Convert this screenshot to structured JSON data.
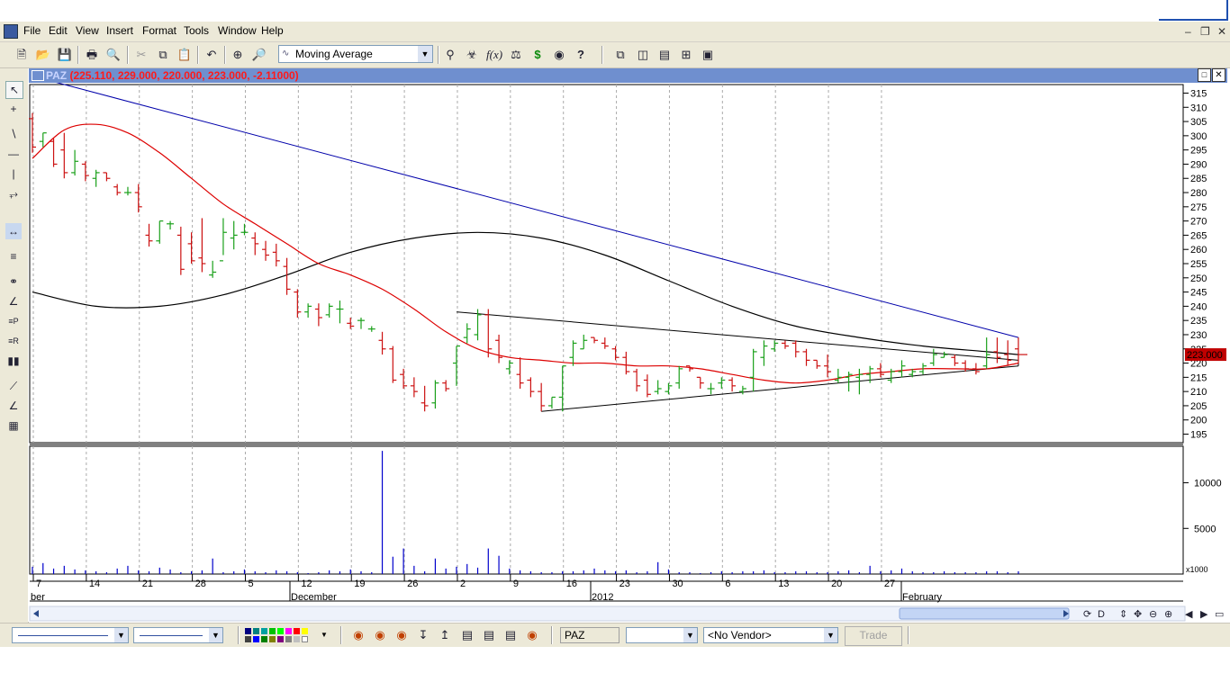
{
  "menu": {
    "items": [
      "File",
      "Edit",
      "View",
      "Insert",
      "Format",
      "Tools",
      "Window",
      "Help"
    ]
  },
  "toolbar": {
    "study_select": "Moving Average"
  },
  "chart_window": {
    "symbol": "PAZ",
    "ohlc_readout": "(225.110, 229.000, 220.000, 223.000, -2.11000)",
    "current_price_tag": "223.000",
    "volume_scale_label": "x1000"
  },
  "status_bar": {
    "symbol_field": "PAZ",
    "vendor": "<No Vendor>",
    "trade_button": "Trade"
  },
  "colors": {
    "price_up": "#1aa01a",
    "price_down": "#cc1111",
    "moving_average": "#dd0000",
    "long_average": "#000000",
    "trendline": "#0000aa",
    "volume": "#0000cc",
    "price_tag_bg": "#c00000"
  },
  "chart_data": {
    "type": "bar",
    "price_axis": {
      "ticks": [
        315,
        310,
        305,
        300,
        295,
        290,
        285,
        280,
        275,
        270,
        265,
        260,
        255,
        250,
        245,
        240,
        235,
        230,
        225,
        220,
        215,
        210,
        205,
        200,
        195
      ],
      "range": [
        192,
        318
      ]
    },
    "volume_axis": {
      "ticks": [
        10000,
        5000
      ],
      "range": [
        0,
        14000
      ]
    },
    "date_axis": {
      "day_labels": [
        "7",
        "14",
        "21",
        "28",
        "5",
        "12",
        "19",
        "26",
        "2",
        "9",
        "16",
        "23",
        "30",
        "6",
        "13",
        "20",
        "27"
      ],
      "month_labels": [
        "ber",
        "December",
        "2012",
        "February"
      ]
    },
    "bars": [
      {
        "o": 306,
        "h": 308,
        "l": 294,
        "c": 296
      },
      {
        "o": 298,
        "h": 301,
        "l": 296,
        "c": 301
      },
      {
        "o": 298,
        "h": 299,
        "l": 289,
        "c": 290
      },
      {
        "o": 295,
        "h": 301,
        "l": 285,
        "c": 287
      },
      {
        "o": 287,
        "h": 295,
        "l": 286,
        "c": 291
      },
      {
        "o": 290,
        "h": 291,
        "l": 284,
        "c": 286
      },
      {
        "o": 285,
        "h": 288,
        "l": 282,
        "c": 287
      },
      {
        "o": 287,
        "h": 287,
        "l": 284,
        "c": 285
      },
      {
        "o": 282,
        "h": 283,
        "l": 279,
        "c": 280
      },
      {
        "o": 280,
        "h": 282,
        "l": 279,
        "c": 280
      },
      {
        "o": 280,
        "h": 283,
        "l": 273,
        "c": 275
      },
      {
        "o": 265,
        "h": 269,
        "l": 261,
        "c": 263
      },
      {
        "o": 263,
        "h": 270,
        "l": 262,
        "c": 270
      },
      {
        "o": 269,
        "h": 270,
        "l": 267,
        "c": 269
      },
      {
        "o": 265,
        "h": 268,
        "l": 251,
        "c": 253
      },
      {
        "o": 262,
        "h": 266,
        "l": 255,
        "c": 256
      },
      {
        "o": 257,
        "h": 271,
        "l": 252,
        "c": 255
      },
      {
        "o": 251,
        "h": 256,
        "l": 250,
        "c": 252
      },
      {
        "o": 256,
        "h": 271,
        "l": 258,
        "c": 266
      },
      {
        "o": 264,
        "h": 270,
        "l": 260,
        "c": 265
      },
      {
        "o": 266,
        "h": 269,
        "l": 265,
        "c": 266
      },
      {
        "o": 264,
        "h": 266,
        "l": 258,
        "c": 262
      },
      {
        "o": 260,
        "h": 263,
        "l": 256,
        "c": 258
      },
      {
        "o": 259,
        "h": 262,
        "l": 254,
        "c": 256
      },
      {
        "o": 254,
        "h": 257,
        "l": 244,
        "c": 246
      },
      {
        "o": 245,
        "h": 246,
        "l": 236,
        "c": 238
      },
      {
        "o": 238,
        "h": 241,
        "l": 236,
        "c": 240
      },
      {
        "o": 239,
        "h": 241,
        "l": 233,
        "c": 236
      },
      {
        "o": 237,
        "h": 241,
        "l": 236,
        "c": 240
      },
      {
        "o": 239,
        "h": 242,
        "l": 234,
        "c": 239
      },
      {
        "o": 234,
        "h": 236,
        "l": 232,
        "c": 233
      },
      {
        "o": 235,
        "h": 236,
        "l": 232,
        "c": 235
      },
      {
        "o": 232,
        "h": 233,
        "l": 231,
        "c": 232
      },
      {
        "o": 228,
        "h": 231,
        "l": 223,
        "c": 225
      },
      {
        "o": 225,
        "h": 226,
        "l": 213,
        "c": 214
      },
      {
        "o": 216,
        "h": 218,
        "l": 211,
        "c": 212
      },
      {
        "o": 212,
        "h": 215,
        "l": 208,
        "c": 210
      },
      {
        "o": 206,
        "h": 212,
        "l": 203,
        "c": 205
      },
      {
        "o": 206,
        "h": 214,
        "l": 204,
        "c": 213
      },
      {
        "o": 213,
        "h": 214,
        "l": 210,
        "c": 211
      },
      {
        "o": 220,
        "h": 226,
        "l": 212,
        "c": 226
      },
      {
        "o": 229,
        "h": 234,
        "l": 227,
        "c": 232
      },
      {
        "o": 230,
        "h": 239,
        "l": 228,
        "c": 237
      },
      {
        "o": 237,
        "h": 239,
        "l": 222,
        "c": 225
      },
      {
        "o": 228,
        "h": 230,
        "l": 220,
        "c": 222
      },
      {
        "o": 218,
        "h": 221,
        "l": 216,
        "c": 220
      },
      {
        "o": 216,
        "h": 222,
        "l": 211,
        "c": 213
      },
      {
        "o": 214,
        "h": 215,
        "l": 208,
        "c": 210
      },
      {
        "o": 210,
        "h": 213,
        "l": 203,
        "c": 205
      },
      {
        "o": 205,
        "h": 208,
        "l": 204,
        "c": 208
      },
      {
        "o": 208,
        "h": 219,
        "l": 203,
        "c": 219
      },
      {
        "o": 222,
        "h": 228,
        "l": 219,
        "c": 227
      },
      {
        "o": 225,
        "h": 230,
        "l": 225,
        "c": 228
      },
      {
        "o": 229,
        "h": 229,
        "l": 227,
        "c": 228
      },
      {
        "o": 227,
        "h": 229,
        "l": 225,
        "c": 226
      },
      {
        "o": 225,
        "h": 226,
        "l": 221,
        "c": 222
      },
      {
        "o": 222,
        "h": 224,
        "l": 216,
        "c": 217
      },
      {
        "o": 217,
        "h": 218,
        "l": 210,
        "c": 212
      },
      {
        "o": 214,
        "h": 216,
        "l": 208,
        "c": 209
      },
      {
        "o": 210,
        "h": 214,
        "l": 209,
        "c": 211
      },
      {
        "o": 210,
        "h": 213,
        "l": 209,
        "c": 212
      },
      {
        "o": 213,
        "h": 219,
        "l": 211,
        "c": 218
      },
      {
        "o": 219,
        "h": 219,
        "l": 217,
        "c": 218
      },
      {
        "o": 215,
        "h": 215,
        "l": 211,
        "c": 213
      },
      {
        "o": 211,
        "h": 213,
        "l": 209,
        "c": 211
      },
      {
        "o": 213,
        "h": 215,
        "l": 211,
        "c": 214
      },
      {
        "o": 214,
        "h": 215,
        "l": 210,
        "c": 212
      },
      {
        "o": 210,
        "h": 212,
        "l": 209,
        "c": 211
      },
      {
        "o": 215,
        "h": 225,
        "l": 210,
        "c": 224
      },
      {
        "o": 222,
        "h": 228,
        "l": 219,
        "c": 226
      },
      {
        "o": 225,
        "h": 228,
        "l": 224,
        "c": 227
      },
      {
        "o": 227,
        "h": 228,
        "l": 225,
        "c": 226
      },
      {
        "o": 227,
        "h": 228,
        "l": 222,
        "c": 224
      },
      {
        "o": 224,
        "h": 225,
        "l": 219,
        "c": 221
      },
      {
        "o": 221,
        "h": 221,
        "l": 218,
        "c": 219
      },
      {
        "o": 219,
        "h": 223,
        "l": 215,
        "c": 217
      },
      {
        "o": 214,
        "h": 218,
        "l": 213,
        "c": 215
      },
      {
        "o": 215,
        "h": 217,
        "l": 210,
        "c": 216
      },
      {
        "o": 215,
        "h": 218,
        "l": 209,
        "c": 216
      },
      {
        "o": 216,
        "h": 219,
        "l": 213,
        "c": 218
      },
      {
        "o": 218,
        "h": 220,
        "l": 215,
        "c": 216
      },
      {
        "o": 214,
        "h": 218,
        "l": 213,
        "c": 217
      },
      {
        "o": 217,
        "h": 221,
        "l": 215,
        "c": 219
      },
      {
        "o": 216,
        "h": 218,
        "l": 215,
        "c": 217
      },
      {
        "o": 217,
        "h": 220,
        "l": 216,
        "c": 219
      },
      {
        "o": 220,
        "h": 225,
        "l": 219,
        "c": 223
      },
      {
        "o": 222,
        "h": 224,
        "l": 222,
        "c": 223
      },
      {
        "o": 222,
        "h": 223,
        "l": 219,
        "c": 220
      },
      {
        "o": 220,
        "h": 221,
        "l": 217,
        "c": 218
      },
      {
        "o": 218,
        "h": 220,
        "l": 216,
        "c": 217
      },
      {
        "o": 219,
        "h": 229,
        "l": 218,
        "c": 223
      },
      {
        "o": 224,
        "h": 229,
        "l": 220,
        "c": 222
      },
      {
        "o": 223,
        "h": 228,
        "l": 219,
        "c": 221
      },
      {
        "o": 225,
        "h": 229,
        "l": 220,
        "c": 223
      }
    ],
    "moving_average": [
      [
        0,
        292
      ],
      [
        3,
        302
      ],
      [
        6,
        304
      ],
      [
        9,
        301
      ],
      [
        12,
        294
      ],
      [
        15,
        285
      ],
      [
        18,
        276
      ],
      [
        21,
        269
      ],
      [
        24,
        262
      ],
      [
        27,
        255
      ],
      [
        30,
        251
      ],
      [
        33,
        246
      ],
      [
        36,
        239
      ],
      [
        39,
        231
      ],
      [
        42,
        225
      ],
      [
        45,
        222
      ],
      [
        48,
        221
      ],
      [
        51,
        220
      ],
      [
        54,
        220
      ],
      [
        57,
        219
      ],
      [
        60,
        219
      ],
      [
        63,
        218
      ],
      [
        66,
        216
      ],
      [
        69,
        214
      ],
      [
        72,
        213
      ],
      [
        75,
        214
      ],
      [
        78,
        216
      ],
      [
        81,
        217
      ],
      [
        84,
        218
      ],
      [
        87,
        218
      ],
      [
        90,
        218
      ],
      [
        93,
        220
      ]
    ],
    "long_average": [
      [
        0,
        245
      ],
      [
        6,
        240
      ],
      [
        12,
        240
      ],
      [
        18,
        244
      ],
      [
        24,
        251
      ],
      [
        30,
        259
      ],
      [
        36,
        264
      ],
      [
        42,
        266
      ],
      [
        48,
        264
      ],
      [
        54,
        258
      ],
      [
        60,
        249
      ],
      [
        66,
        240
      ],
      [
        72,
        233
      ],
      [
        78,
        229
      ],
      [
        84,
        226
      ],
      [
        90,
        224
      ],
      [
        93,
        223
      ]
    ],
    "trendlines": [
      {
        "from": [
          0,
          321
        ],
        "to": [
          93,
          229
        ],
        "color": "blue"
      },
      {
        "from": [
          40,
          238
        ],
        "to": [
          93,
          221
        ],
        "color": "black"
      },
      {
        "from": [
          48,
          203
        ],
        "to": [
          93,
          219
        ],
        "color": "black"
      }
    ],
    "volume": [
      800,
      1200,
      600,
      900,
      500,
      400,
      300,
      200,
      600,
      900,
      400,
      300,
      700,
      500,
      200,
      300,
      400,
      1700,
      200,
      300,
      500,
      300,
      200,
      400,
      300,
      200,
      100,
      200,
      400,
      300,
      500,
      300,
      200,
      13500,
      1900,
      2800,
      900,
      300,
      1700,
      600,
      800,
      1100,
      700,
      2800,
      2000,
      600,
      400,
      300,
      200,
      200,
      300,
      300,
      400,
      600,
      400,
      300,
      400,
      200,
      300,
      1300,
      500,
      200,
      200,
      100,
      200,
      300,
      200,
      300,
      300,
      400,
      200,
      200,
      300,
      300,
      200,
      200,
      300,
      400,
      200,
      900,
      300,
      400,
      600,
      300,
      200,
      200,
      300,
      200,
      200,
      200,
      300,
      300,
      200,
      300
    ],
    "grid": true
  }
}
